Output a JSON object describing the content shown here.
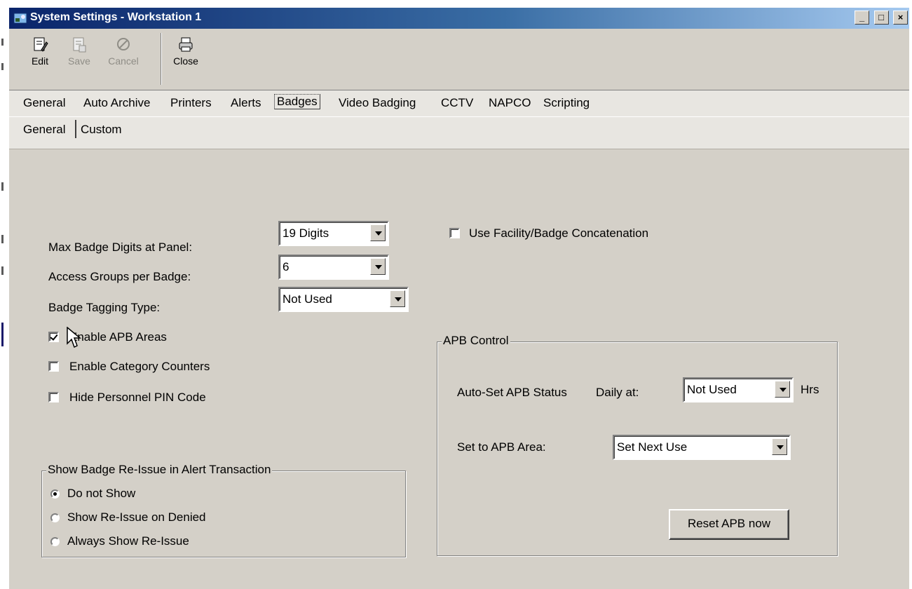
{
  "window": {
    "title": "System Settings - Workstation 1",
    "controls": {
      "minimize": "_",
      "maximize": "□",
      "close": "×"
    }
  },
  "toolbar": {
    "edit_label": "Edit",
    "save_label": "Save",
    "cancel_label": "Cancel",
    "close_label": "Close"
  },
  "tabs": {
    "main": [
      "General",
      "Auto Archive",
      "Printers",
      "Alerts",
      "Badges",
      "Video Badging",
      "CCTV",
      "NAPCO",
      "Scripting"
    ],
    "active_main": "Badges",
    "sub": [
      "General",
      "Custom"
    ],
    "active_sub": "General"
  },
  "form": {
    "max_badge_digits": {
      "label": "Max Badge Digits at Panel:",
      "value": "19 Digits"
    },
    "access_groups": {
      "label": "Access Groups per Badge:",
      "value": "6"
    },
    "badge_tagging": {
      "label": "Badge Tagging Type:",
      "value": "Not Used"
    },
    "use_facility_concat": {
      "label": "Use Facility/Badge Concatenation",
      "checked": false
    },
    "enable_apb_areas": {
      "label": "Enable APB Areas",
      "checked": true
    },
    "enable_category_counters": {
      "label": "Enable Category Counters",
      "checked": false
    },
    "hide_pin_code": {
      "label": "Hide Personnel PIN Code",
      "checked": false
    }
  },
  "reissue_group": {
    "legend": "Show Badge Re-Issue in Alert Transaction",
    "options": [
      "Do not Show",
      "Show Re-Issue on Denied",
      "Always Show Re-Issue"
    ],
    "selected": "Do not Show"
  },
  "apb_group": {
    "legend": "APB Control",
    "auto_set_label": "Auto-Set APB Status",
    "daily_at_label": "Daily at:",
    "daily_value": "Not Used",
    "hrs_label": "Hrs",
    "set_area_label": "Set to APB Area:",
    "set_area_value": "Set Next Use",
    "reset_button": "Reset APB now"
  }
}
